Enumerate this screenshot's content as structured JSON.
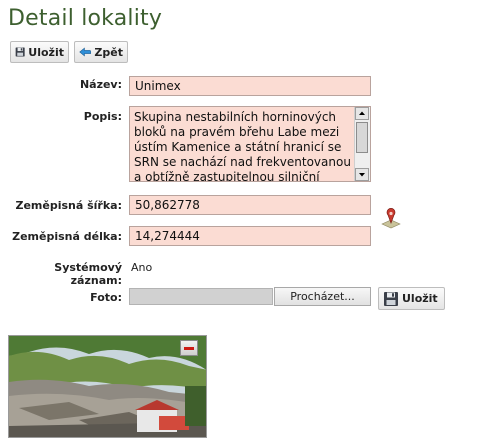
{
  "page_title": "Detail lokality",
  "toolbar": {
    "save_label": "Uložit",
    "back_label": "Zpět"
  },
  "form": {
    "name": {
      "label": "Název:",
      "value": "Unimex"
    },
    "description": {
      "label": "Popis:",
      "value": "Skupina nestabilních horninových bloků na pravém břehu Labe mezi ústím Kamenice a státní hranicí se SRN se nachází nad frekventovanou a obtížně zastupitelnou silniční"
    },
    "latitude": {
      "label": "Zeměpisná šířka:",
      "value": "50,862778"
    },
    "longitude": {
      "label": "Zeměpisná délka:",
      "value": "14,274444"
    },
    "system_record": {
      "label": "Systémový záznam:",
      "value": "Ano"
    },
    "photo": {
      "label": "Foto:",
      "browse_label": "Procházet...",
      "save_label": "Uložit"
    }
  },
  "icons": {
    "save": "floppy-disk-icon",
    "back": "back-arrow-icon",
    "map": "map-pin-icon",
    "delete": "delete-photo-icon"
  },
  "colors": {
    "title": "#3d5f2f",
    "field_bg": "#fbdcd3"
  }
}
